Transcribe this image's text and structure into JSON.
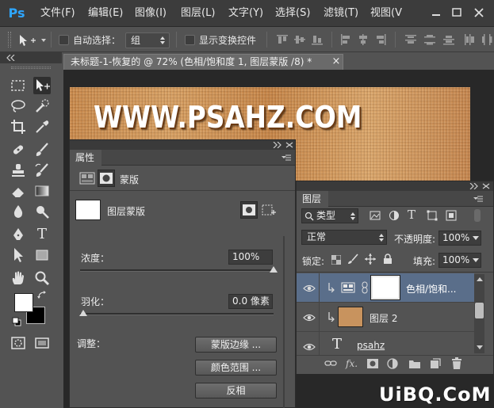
{
  "app": {
    "logo": "Ps"
  },
  "menu": [
    "文件(F)",
    "编辑(E)",
    "图像(I)",
    "图层(L)",
    "文字(Y)",
    "选择(S)",
    "滤镜(T)",
    "视图(V"
  ],
  "options_bar": {
    "auto_select_label": "自动选择：",
    "auto_select_value": "组",
    "show_transform_label": "显示变换控件"
  },
  "document": {
    "tab_title": "未标题-1-恢复的 @ 72% (色相/饱和度 1, 图层蒙版 /8) *",
    "close_glyph": "×",
    "canvas_text": "WWW.PSAHZ.COM"
  },
  "properties": {
    "tab": "属性",
    "header_label": "蒙版",
    "mask_type_label": "图层蒙版",
    "density_label": "浓度：",
    "density_value": "100%",
    "density_level": 1.0,
    "feather_label": "羽化：",
    "feather_value": "0.0 像素",
    "feather_level": 0.0,
    "refine_label": "调整：",
    "buttons": [
      "蒙版边缘 ...",
      "颜色范围 ...",
      "反相"
    ]
  },
  "layers": {
    "tab": "图层",
    "filter_kind": "类型",
    "blend_mode": "正常",
    "opacity_label": "不透明度:",
    "opacity_value": "100%",
    "lock_label": "锁定:",
    "fill_label": "填充:",
    "fill_value": "100%",
    "rows": [
      {
        "name": "色相/饱和...",
        "selected": true
      },
      {
        "name": "图层 2",
        "selected": false
      },
      {
        "name": "psahz",
        "selected": false
      }
    ],
    "text_layer_glyph": "T"
  },
  "tools": {
    "text_glyph": "T"
  },
  "colors": {
    "accent_selected_row": "#5a6e8a",
    "ps_blue": "#2ea6ff",
    "foreground_swatch": "#ffffff",
    "background_swatch": "#000000",
    "layer2_thumb": "#c8935e"
  },
  "watermark": "UiBQ.CoM"
}
